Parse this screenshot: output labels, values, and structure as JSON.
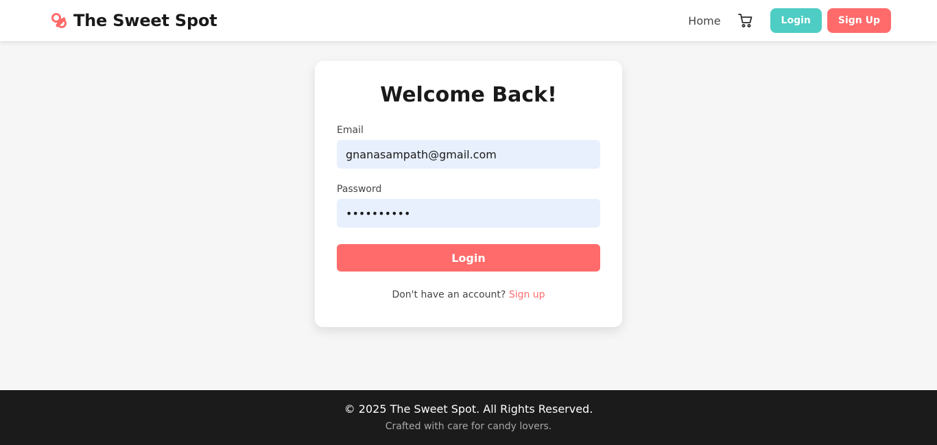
{
  "brand": {
    "title": "The Sweet Spot",
    "icon": "candy-icon",
    "icon_color": "#ff6b6b"
  },
  "nav": {
    "home": "Home",
    "cart_icon": "cart-icon",
    "login": "Login",
    "signup": "Sign Up"
  },
  "form": {
    "title": "Welcome Back!",
    "email_label": "Email",
    "email_value": "gnanasampath@gmail.com",
    "password_label": "Password",
    "password_value": "••••••••••",
    "submit": "Login",
    "switch_prompt": "Don't have an account? ",
    "switch_link": "Sign up"
  },
  "footer": {
    "copyright": "© 2025 The Sweet Spot. All Rights Reserved.",
    "tagline": "Crafted with care for candy lovers."
  },
  "colors": {
    "accent_teal": "#4ecdc4",
    "accent_coral": "#ff6b6b",
    "input_bg": "#e8f0fe",
    "footer_bg": "#1b1b1b"
  }
}
